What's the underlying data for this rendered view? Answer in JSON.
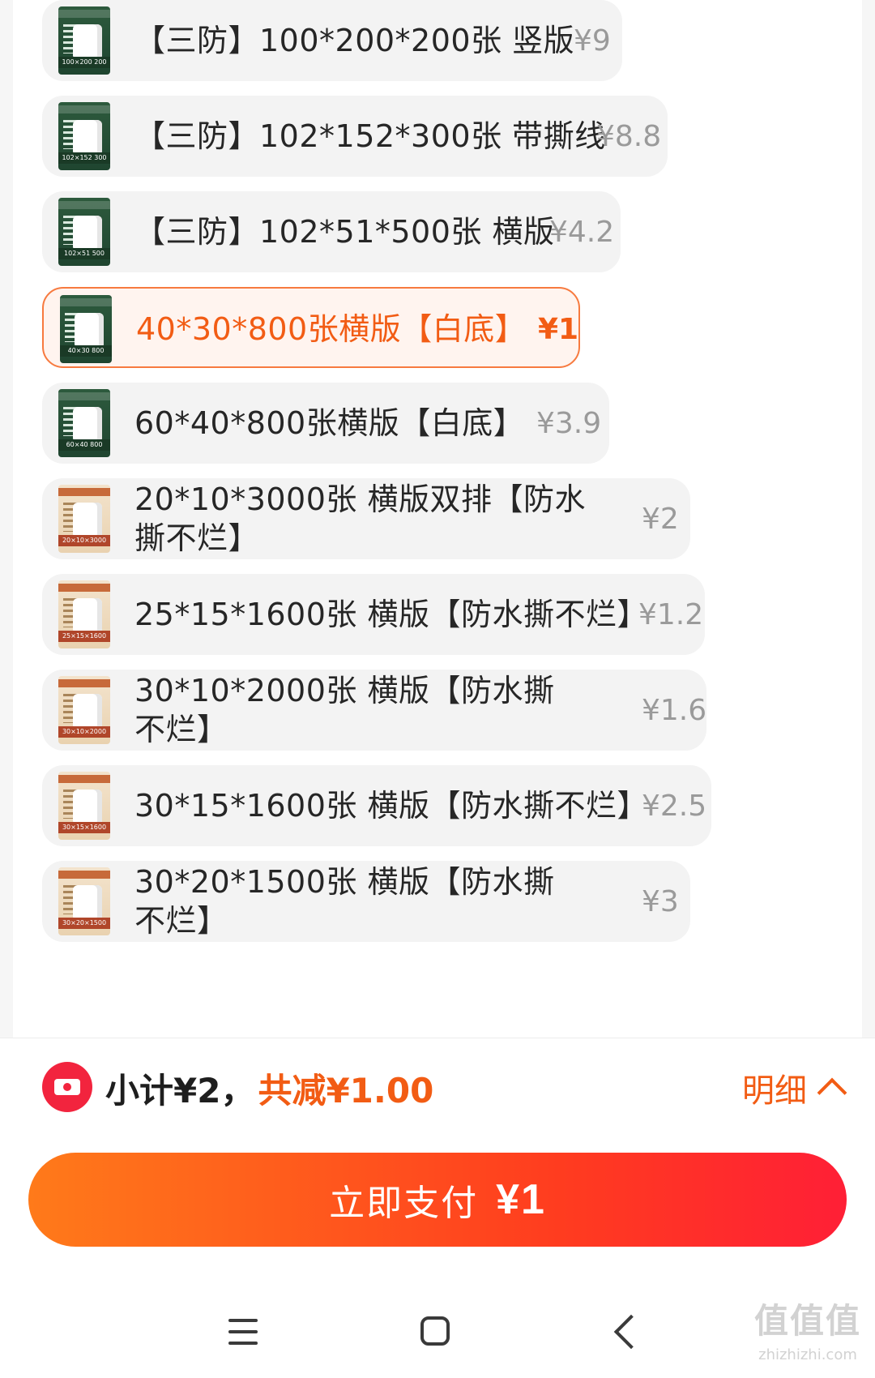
{
  "options": [
    {
      "label": "【三防】100*200*200张 竖版",
      "price": "¥9",
      "thumb_caption": "100×200 200",
      "thumb_style": "green",
      "selected": false
    },
    {
      "label": "【三防】102*152*300张 带撕线",
      "price": "¥8.8",
      "thumb_caption": "102×152 300",
      "thumb_style": "green",
      "selected": false
    },
    {
      "label": "【三防】102*51*500张 横版",
      "price": "¥4.2",
      "thumb_caption": "102×51 500",
      "thumb_style": "green",
      "selected": false
    },
    {
      "label": "40*30*800张横版【白底】",
      "price": "¥1",
      "thumb_caption": "40×30 800",
      "thumb_style": "green",
      "selected": true
    },
    {
      "label": "60*40*800张横版【白底】",
      "price": "¥3.9",
      "thumb_caption": "60×40 800",
      "thumb_style": "green",
      "selected": false
    },
    {
      "label": "20*10*3000张 横版双排【防水撕不烂】",
      "price": "¥2",
      "thumb_caption": "20×10×3000",
      "thumb_style": "beige",
      "selected": false
    },
    {
      "label": "25*15*1600张 横版【防水撕不烂】",
      "price": "¥1.2",
      "thumb_caption": "25×15×1600",
      "thumb_style": "beige",
      "selected": false
    },
    {
      "label": "30*10*2000张 横版【防水撕不烂】",
      "price": "¥1.6",
      "thumb_caption": "30×10×2000",
      "thumb_style": "beige",
      "selected": false
    },
    {
      "label": "30*15*1600张 横版【防水撕不烂】",
      "price": "¥2.5",
      "thumb_caption": "30×15×1600",
      "thumb_style": "beige",
      "selected": false
    },
    {
      "label": "30*20*1500张 横版【防水撕不烂】",
      "price": "¥3",
      "thumb_caption": "30×20×1500",
      "thumb_style": "beige",
      "selected": false
    }
  ],
  "summary": {
    "subtotal_text": "小计¥2，",
    "discount_text": "共减¥1.00",
    "detail_label": "明细"
  },
  "pay": {
    "label": "立即支付",
    "amount": "¥1"
  },
  "watermark": {
    "big": "值值值",
    "small": "zhizhizhi.com"
  },
  "colors": {
    "accent": "#f25c14",
    "pay_gradient_start": "#ff7a1a",
    "pay_gradient_end": "#ff1f36",
    "coupon_red": "#f2243e"
  },
  "icons": {
    "coupon": "coupon-icon",
    "detail_toggle": "chevron-up-icon",
    "nav_menu": "menu-icon",
    "nav_home": "home-icon",
    "nav_back": "back-icon"
  }
}
